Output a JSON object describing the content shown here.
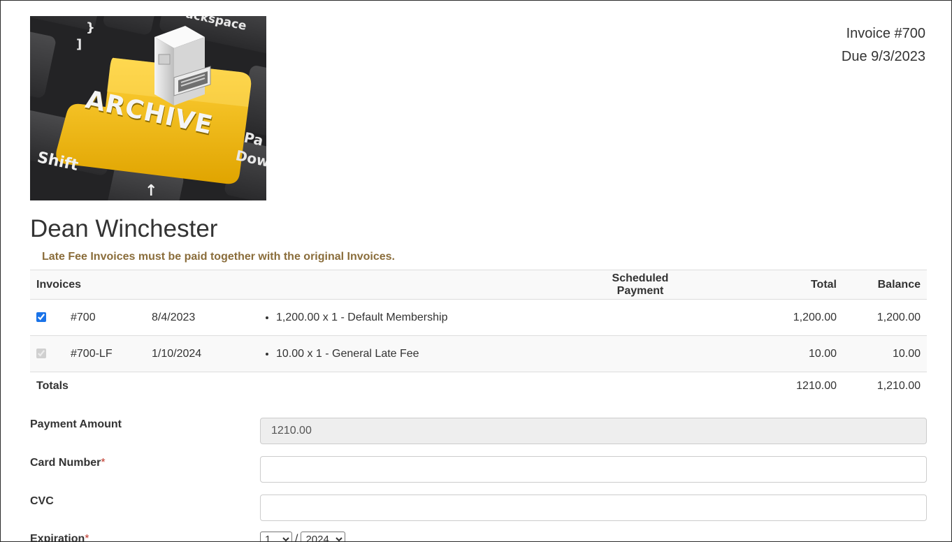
{
  "logo": {
    "alt": "archive-keyboard-logo",
    "key_labels": {
      "main": "ARCHIVE",
      "shift": "Shift",
      "backspace": "ackspace",
      "pgdn_top": "Pa",
      "pgdn_bottom": "Dow",
      "bracket": "}",
      "bracket2": "]"
    },
    "colors": {
      "key_yellow": "#f2b705",
      "key_dark": "#2b2b2d"
    }
  },
  "invoice": {
    "number_label": "Invoice #700",
    "due_label": "Due 9/3/2023"
  },
  "customer": {
    "name": "Dean Winchester"
  },
  "notice": "Late Fee Invoices must be paid together with the original Invoices.",
  "table": {
    "headers": {
      "invoices": "Invoices",
      "scheduled_payment": "Scheduled Payment",
      "total": "Total",
      "balance": "Balance"
    },
    "rows": [
      {
        "checked": true,
        "disabled": false,
        "number": "#700",
        "date": "8/4/2023",
        "item": "1,200.00 x 1 - Default Membership",
        "total": "1,200.00",
        "balance": "1,200.00"
      },
      {
        "checked": true,
        "disabled": true,
        "number": "#700-LF",
        "date": "1/10/2024",
        "item": "10.00 x 1 - General Late Fee",
        "total": "10.00",
        "balance": "10.00"
      }
    ],
    "totals": {
      "label": "Totals",
      "total": "1210.00",
      "balance": "1,210.00"
    }
  },
  "form": {
    "payment_amount": {
      "label": "Payment Amount",
      "value": "1210.00"
    },
    "card_number": {
      "label": "Card Number",
      "required_mark": "*",
      "value": ""
    },
    "cvc": {
      "label": "CVC",
      "value": ""
    },
    "expiration": {
      "label": "Expiration",
      "required_mark": "*",
      "month": "1",
      "separator": "/",
      "year": "2024"
    }
  },
  "colors": {
    "notice_text": "#8a6d3b",
    "required": "#c0392b",
    "checkbox": "#1a73e8",
    "table_stripe": "#f9f9f9",
    "readonly_bg": "#eeeeee"
  }
}
